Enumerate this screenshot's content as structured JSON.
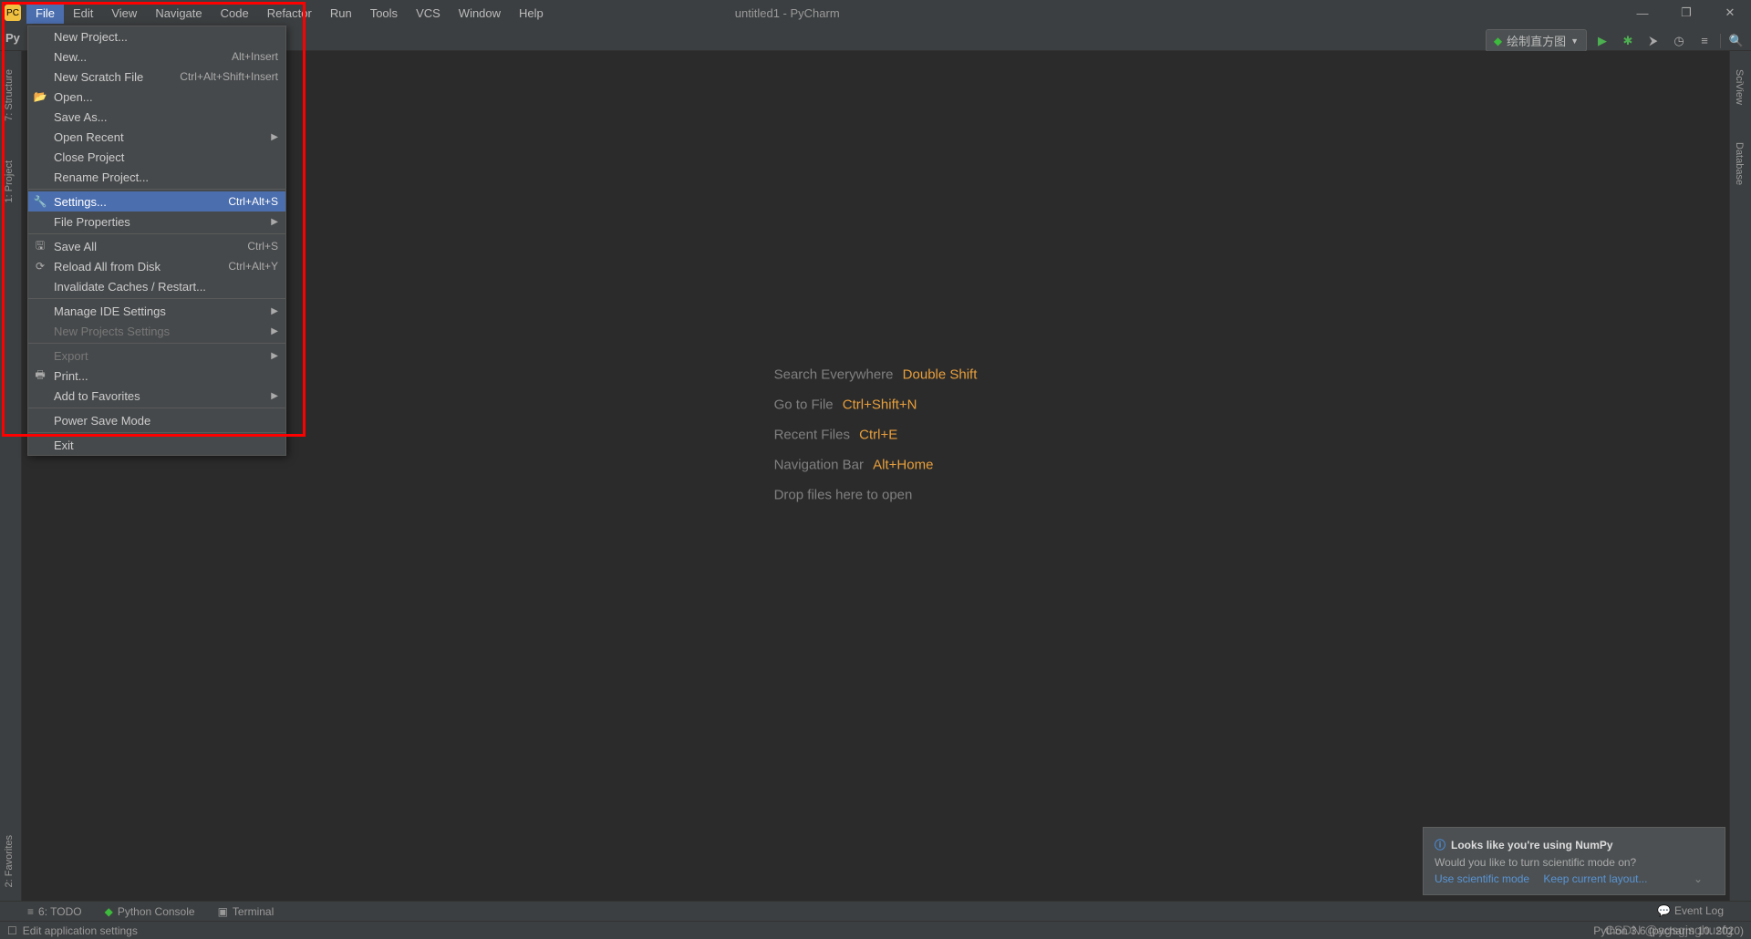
{
  "window": {
    "title": "untitled1 - PyCharm"
  },
  "menubar": {
    "items": [
      "File",
      "Edit",
      "View",
      "Navigate",
      "Code",
      "Refactor",
      "Run",
      "Tools",
      "VCS",
      "Window",
      "Help"
    ]
  },
  "breadcrumb": {
    "root": "Py"
  },
  "run_config": {
    "label": "绘制直方图"
  },
  "left_tabs": {
    "favorites": "2: Favorites",
    "project": "1: Project",
    "structure": "7: Structure"
  },
  "right_tabs": {
    "sciview": "SciView",
    "database": "Database"
  },
  "hints": {
    "row1_label": "Search Everywhere",
    "row1_key": "Double Shift",
    "row2_label": "Go to File",
    "row2_key": "Ctrl+Shift+N",
    "row3_label": "Recent Files",
    "row3_key": "Ctrl+E",
    "row4_label": "Navigation Bar",
    "row4_key": "Alt+Home",
    "row5_label": "Drop files here to open"
  },
  "file_menu": {
    "new_project": "New Project...",
    "new": "New...",
    "new_sc": "Alt+Insert",
    "new_scratch": "New Scratch File",
    "new_scratch_sc": "Ctrl+Alt+Shift+Insert",
    "open": "Open...",
    "save_as": "Save As...",
    "open_recent": "Open Recent",
    "close_project": "Close Project",
    "rename_project": "Rename Project...",
    "settings": "Settings...",
    "settings_sc": "Ctrl+Alt+S",
    "file_properties": "File Properties",
    "save_all": "Save All",
    "save_all_sc": "Ctrl+S",
    "reload": "Reload All from Disk",
    "reload_sc": "Ctrl+Alt+Y",
    "invalidate": "Invalidate Caches / Restart...",
    "manage_ide": "Manage IDE Settings",
    "new_projects_settings": "New Projects Settings",
    "export": "Export",
    "print": "Print...",
    "add_fav": "Add to Favorites",
    "power_save": "Power Save Mode",
    "exit": "Exit"
  },
  "bottom_tabs": {
    "todo": "6: TODO",
    "python_console": "Python Console",
    "terminal": "Terminal"
  },
  "event_log": "Event Log",
  "notification": {
    "title": "Looks like you're using NumPy",
    "body": "Would you like to turn scientific mode on?",
    "link1": "Use scientific mode",
    "link2": "Keep current layout..."
  },
  "status": {
    "left": "Edit application settings",
    "right": "Python 3.6 (pycharm 10. 2020)"
  },
  "watermark": "CSDN @agsgjsghusfg"
}
